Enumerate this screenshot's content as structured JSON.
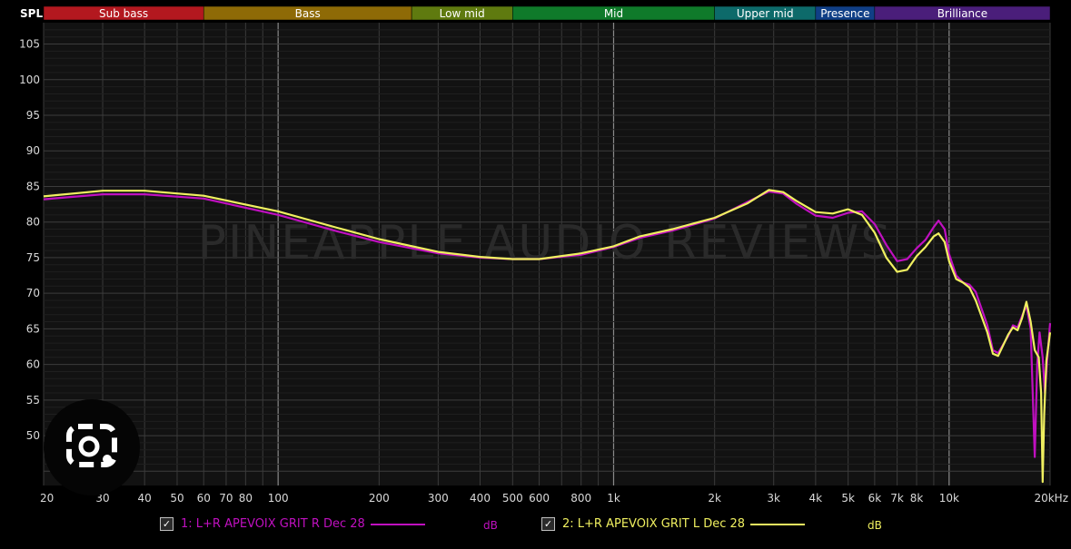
{
  "y_axis_title": "SPL",
  "watermark": "PINEAPPLE AUDIO REVIEWS",
  "bands": [
    {
      "label": "Sub bass",
      "from": 20,
      "to": 60,
      "color": "#b3181f"
    },
    {
      "label": "Bass",
      "from": 60,
      "to": 250,
      "color": "#8e6a06"
    },
    {
      "label": "Low mid",
      "from": 250,
      "to": 500,
      "color": "#5f7a0f"
    },
    {
      "label": "Mid",
      "from": 500,
      "to": 2000,
      "color": "#0f7a2a"
    },
    {
      "label": "Upper mid",
      "from": 2000,
      "to": 4000,
      "color": "#0d6a6a"
    },
    {
      "label": "Presence",
      "from": 4000,
      "to": 6000,
      "color": "#103f86"
    },
    {
      "label": "Brilliance",
      "from": 6000,
      "to": 20000,
      "color": "#4a1e7a"
    }
  ],
  "legend": [
    {
      "label": "1: L+R APEVOIX GRIT R Dec 28",
      "color": "#c010c0",
      "unit": "dB"
    },
    {
      "label": "2: L+R APEVOIX GRIT L Dec 28",
      "color": "#f0f060",
      "unit": "dB"
    }
  ],
  "chart_data": {
    "type": "line",
    "x_scale": "log",
    "xlim": [
      20,
      20000
    ],
    "ylim": [
      43,
      108
    ],
    "ylabel": "SPL",
    "y_ticks": [
      50,
      55,
      60,
      65,
      70,
      75,
      80,
      85,
      90,
      95,
      100,
      105
    ],
    "x_ticks": [
      {
        "v": 20,
        "label": "20"
      },
      {
        "v": 30,
        "label": "30"
      },
      {
        "v": 40,
        "label": "40"
      },
      {
        "v": 50,
        "label": "50"
      },
      {
        "v": 60,
        "label": "60"
      },
      {
        "v": 70,
        "label": "70"
      },
      {
        "v": 80,
        "label": "80"
      },
      {
        "v": 100,
        "label": "100"
      },
      {
        "v": 200,
        "label": "200"
      },
      {
        "v": 300,
        "label": "300"
      },
      {
        "v": 400,
        "label": "400"
      },
      {
        "v": 500,
        "label": "500"
      },
      {
        "v": 600,
        "label": "600"
      },
      {
        "v": 800,
        "label": "800"
      },
      {
        "v": 1000,
        "label": "1k"
      },
      {
        "v": 2000,
        "label": "2k"
      },
      {
        "v": 3000,
        "label": "3k"
      },
      {
        "v": 4000,
        "label": "4k"
      },
      {
        "v": 5000,
        "label": "5k"
      },
      {
        "v": 6000,
        "label": "6k"
      },
      {
        "v": 7000,
        "label": "7k"
      },
      {
        "v": 8000,
        "label": "8k"
      },
      {
        "v": 10000,
        "label": "10k"
      },
      {
        "v": 20000,
        "label": "20kHz"
      }
    ],
    "grid": true,
    "legend_position": "bottom",
    "series": [
      {
        "name": "1: L+R APEVOIX GRIT R Dec 28",
        "color": "#c010c0",
        "points": [
          [
            20,
            83.2
          ],
          [
            30,
            83.9
          ],
          [
            40,
            83.9
          ],
          [
            60,
            83.3
          ],
          [
            100,
            81.0
          ],
          [
            150,
            78.7
          ],
          [
            200,
            77.2
          ],
          [
            300,
            75.6
          ],
          [
            400,
            75.0
          ],
          [
            500,
            74.8
          ],
          [
            600,
            74.8
          ],
          [
            800,
            75.4
          ],
          [
            1000,
            76.5
          ],
          [
            1200,
            77.8
          ],
          [
            1500,
            78.8
          ],
          [
            2000,
            80.5
          ],
          [
            2500,
            82.8
          ],
          [
            2900,
            84.3
          ],
          [
            3200,
            84.0
          ],
          [
            3500,
            82.6
          ],
          [
            4000,
            80.9
          ],
          [
            4500,
            80.6
          ],
          [
            5000,
            81.3
          ],
          [
            5500,
            81.5
          ],
          [
            6000,
            79.7
          ],
          [
            6500,
            76.8
          ],
          [
            7000,
            74.5
          ],
          [
            7500,
            74.8
          ],
          [
            8000,
            76.3
          ],
          [
            8500,
            77.5
          ],
          [
            9000,
            79.3
          ],
          [
            9300,
            80.2
          ],
          [
            9700,
            79.0
          ],
          [
            10000,
            75.5
          ],
          [
            10500,
            72.5
          ],
          [
            11000,
            71.5
          ],
          [
            11500,
            71.2
          ],
          [
            12000,
            70.2
          ],
          [
            13000,
            65.5
          ],
          [
            13500,
            62.0
          ],
          [
            14000,
            61.6
          ],
          [
            15000,
            64.0
          ],
          [
            15500,
            65.5
          ],
          [
            16000,
            65.2
          ],
          [
            16500,
            66.8
          ],
          [
            17000,
            68.3
          ],
          [
            17500,
            65.0
          ],
          [
            18000,
            47.0
          ],
          [
            18300,
            60.0
          ],
          [
            18600,
            64.5
          ],
          [
            19000,
            61.0
          ],
          [
            19300,
            56.0
          ],
          [
            19700,
            62.0
          ],
          [
            20000,
            65.8
          ]
        ]
      },
      {
        "name": "2: L+R APEVOIX GRIT L Dec 28",
        "color": "#f0f060",
        "points": [
          [
            20,
            83.6
          ],
          [
            30,
            84.4
          ],
          [
            40,
            84.4
          ],
          [
            60,
            83.7
          ],
          [
            100,
            81.5
          ],
          [
            150,
            79.2
          ],
          [
            200,
            77.6
          ],
          [
            300,
            75.8
          ],
          [
            400,
            75.1
          ],
          [
            500,
            74.8
          ],
          [
            600,
            74.8
          ],
          [
            800,
            75.6
          ],
          [
            1000,
            76.6
          ],
          [
            1200,
            78.0
          ],
          [
            1500,
            79.0
          ],
          [
            2000,
            80.6
          ],
          [
            2500,
            82.6
          ],
          [
            2900,
            84.5
          ],
          [
            3200,
            84.2
          ],
          [
            3500,
            83.0
          ],
          [
            4000,
            81.4
          ],
          [
            4500,
            81.2
          ],
          [
            5000,
            81.8
          ],
          [
            5500,
            81.0
          ],
          [
            6000,
            78.5
          ],
          [
            6500,
            75.0
          ],
          [
            7000,
            73.0
          ],
          [
            7500,
            73.3
          ],
          [
            8000,
            75.2
          ],
          [
            8500,
            76.5
          ],
          [
            9000,
            78.0
          ],
          [
            9300,
            78.4
          ],
          [
            9700,
            77.2
          ],
          [
            10000,
            74.5
          ],
          [
            10500,
            72.0
          ],
          [
            11000,
            71.5
          ],
          [
            11500,
            70.8
          ],
          [
            12000,
            69.0
          ],
          [
            13000,
            64.5
          ],
          [
            13500,
            61.5
          ],
          [
            14000,
            61.2
          ],
          [
            15000,
            64.2
          ],
          [
            15500,
            65.2
          ],
          [
            16000,
            64.8
          ],
          [
            16500,
            66.5
          ],
          [
            17000,
            68.8
          ],
          [
            17500,
            66.0
          ],
          [
            18000,
            62.0
          ],
          [
            18500,
            61.0
          ],
          [
            18800,
            56.0
          ],
          [
            19000,
            43.5
          ],
          [
            19200,
            53.0
          ],
          [
            19500,
            60.5
          ],
          [
            20000,
            64.5
          ]
        ]
      }
    ]
  }
}
